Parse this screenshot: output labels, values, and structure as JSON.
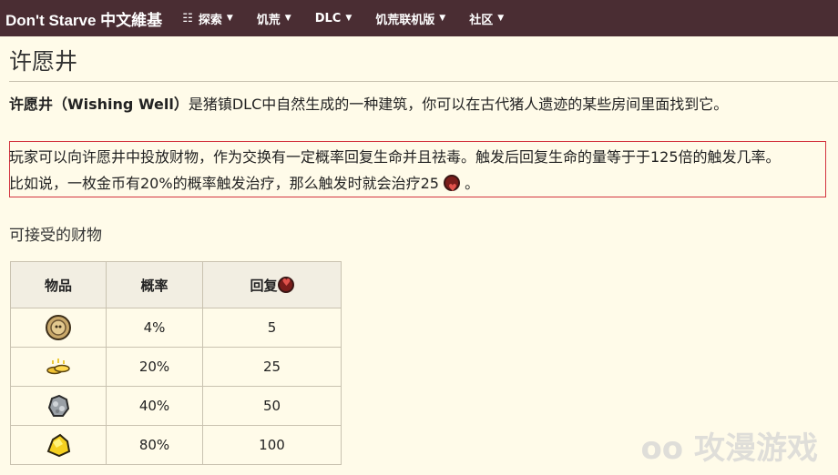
{
  "site": {
    "brand": "Don't Starve 中文維基",
    "nav": [
      {
        "label": "探索",
        "icon": "map-icon"
      },
      {
        "label": "饥荒"
      },
      {
        "label": "DLC"
      },
      {
        "label": "饥荒联机版"
      },
      {
        "label": "社区"
      }
    ]
  },
  "page": {
    "title": "许愿井",
    "intro_bold": "许愿井（Wishing Well）",
    "intro_rest": "是猪镇DLC中自然生成的一种建筑，你可以在古代猪人遗迹的某些房间里面找到它。",
    "para_line1": "玩家可以向许愿井中投放财物，作为交换有一定概率回复生命并且祛毒。触发后回复生命的量等于于125倍的触发几率。",
    "para_line2_a": "比如说，一枚金币有20%的概率触发治疗，那么触发时就会治疗25",
    "para_line2_b": "。",
    "section_heading": "可接受的财物"
  },
  "table": {
    "headers": [
      "物品",
      "概率",
      "回复"
    ],
    "rows": [
      {
        "icon": "oinc-coin-icon",
        "prob": "4%",
        "heal": "5"
      },
      {
        "icon": "gold-coins-icon",
        "prob": "20%",
        "heal": "25"
      },
      {
        "icon": "silver-ore-icon",
        "prob": "40%",
        "heal": "50"
      },
      {
        "icon": "gold-nugget-icon",
        "prob": "80%",
        "heal": "100"
      }
    ]
  },
  "watermark": "oo 攻漫游戏"
}
